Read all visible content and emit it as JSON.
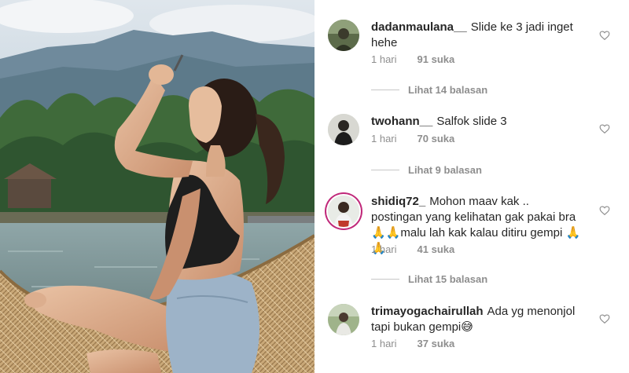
{
  "comments": [
    {
      "username": "dadanmaulana__",
      "text": "Slide ke 3 jadi inget hehe",
      "time": "1 hari",
      "likes": "91 suka",
      "replies": "Lihat 14 balasan"
    },
    {
      "username": "twohann__",
      "text": "Salfok slide 3",
      "time": "1 hari",
      "likes": "70 suka",
      "replies": "Lihat 9 balasan"
    },
    {
      "username": "shidiq72_",
      "text": "Mohon maav kak .. postingan yang kelihatan gak pakai bra 🙏🙏malu lah kak kalau ditiru gempi 🙏🙏",
      "time": "1 hari",
      "likes": "41 suka",
      "replies": "Lihat 15 balasan"
    },
    {
      "username": "trimayogachairullah",
      "text": "Ada yg menonjol tapi bukan gempi😅",
      "time": "1 hari",
      "likes": "37 suka"
    }
  ],
  "icons": {
    "heart": "heart-outline-icon",
    "avatar": "avatar-icon"
  },
  "colors": {
    "text": "#262626",
    "muted": "#8e8e8e",
    "story_ring": "#c0297a"
  }
}
